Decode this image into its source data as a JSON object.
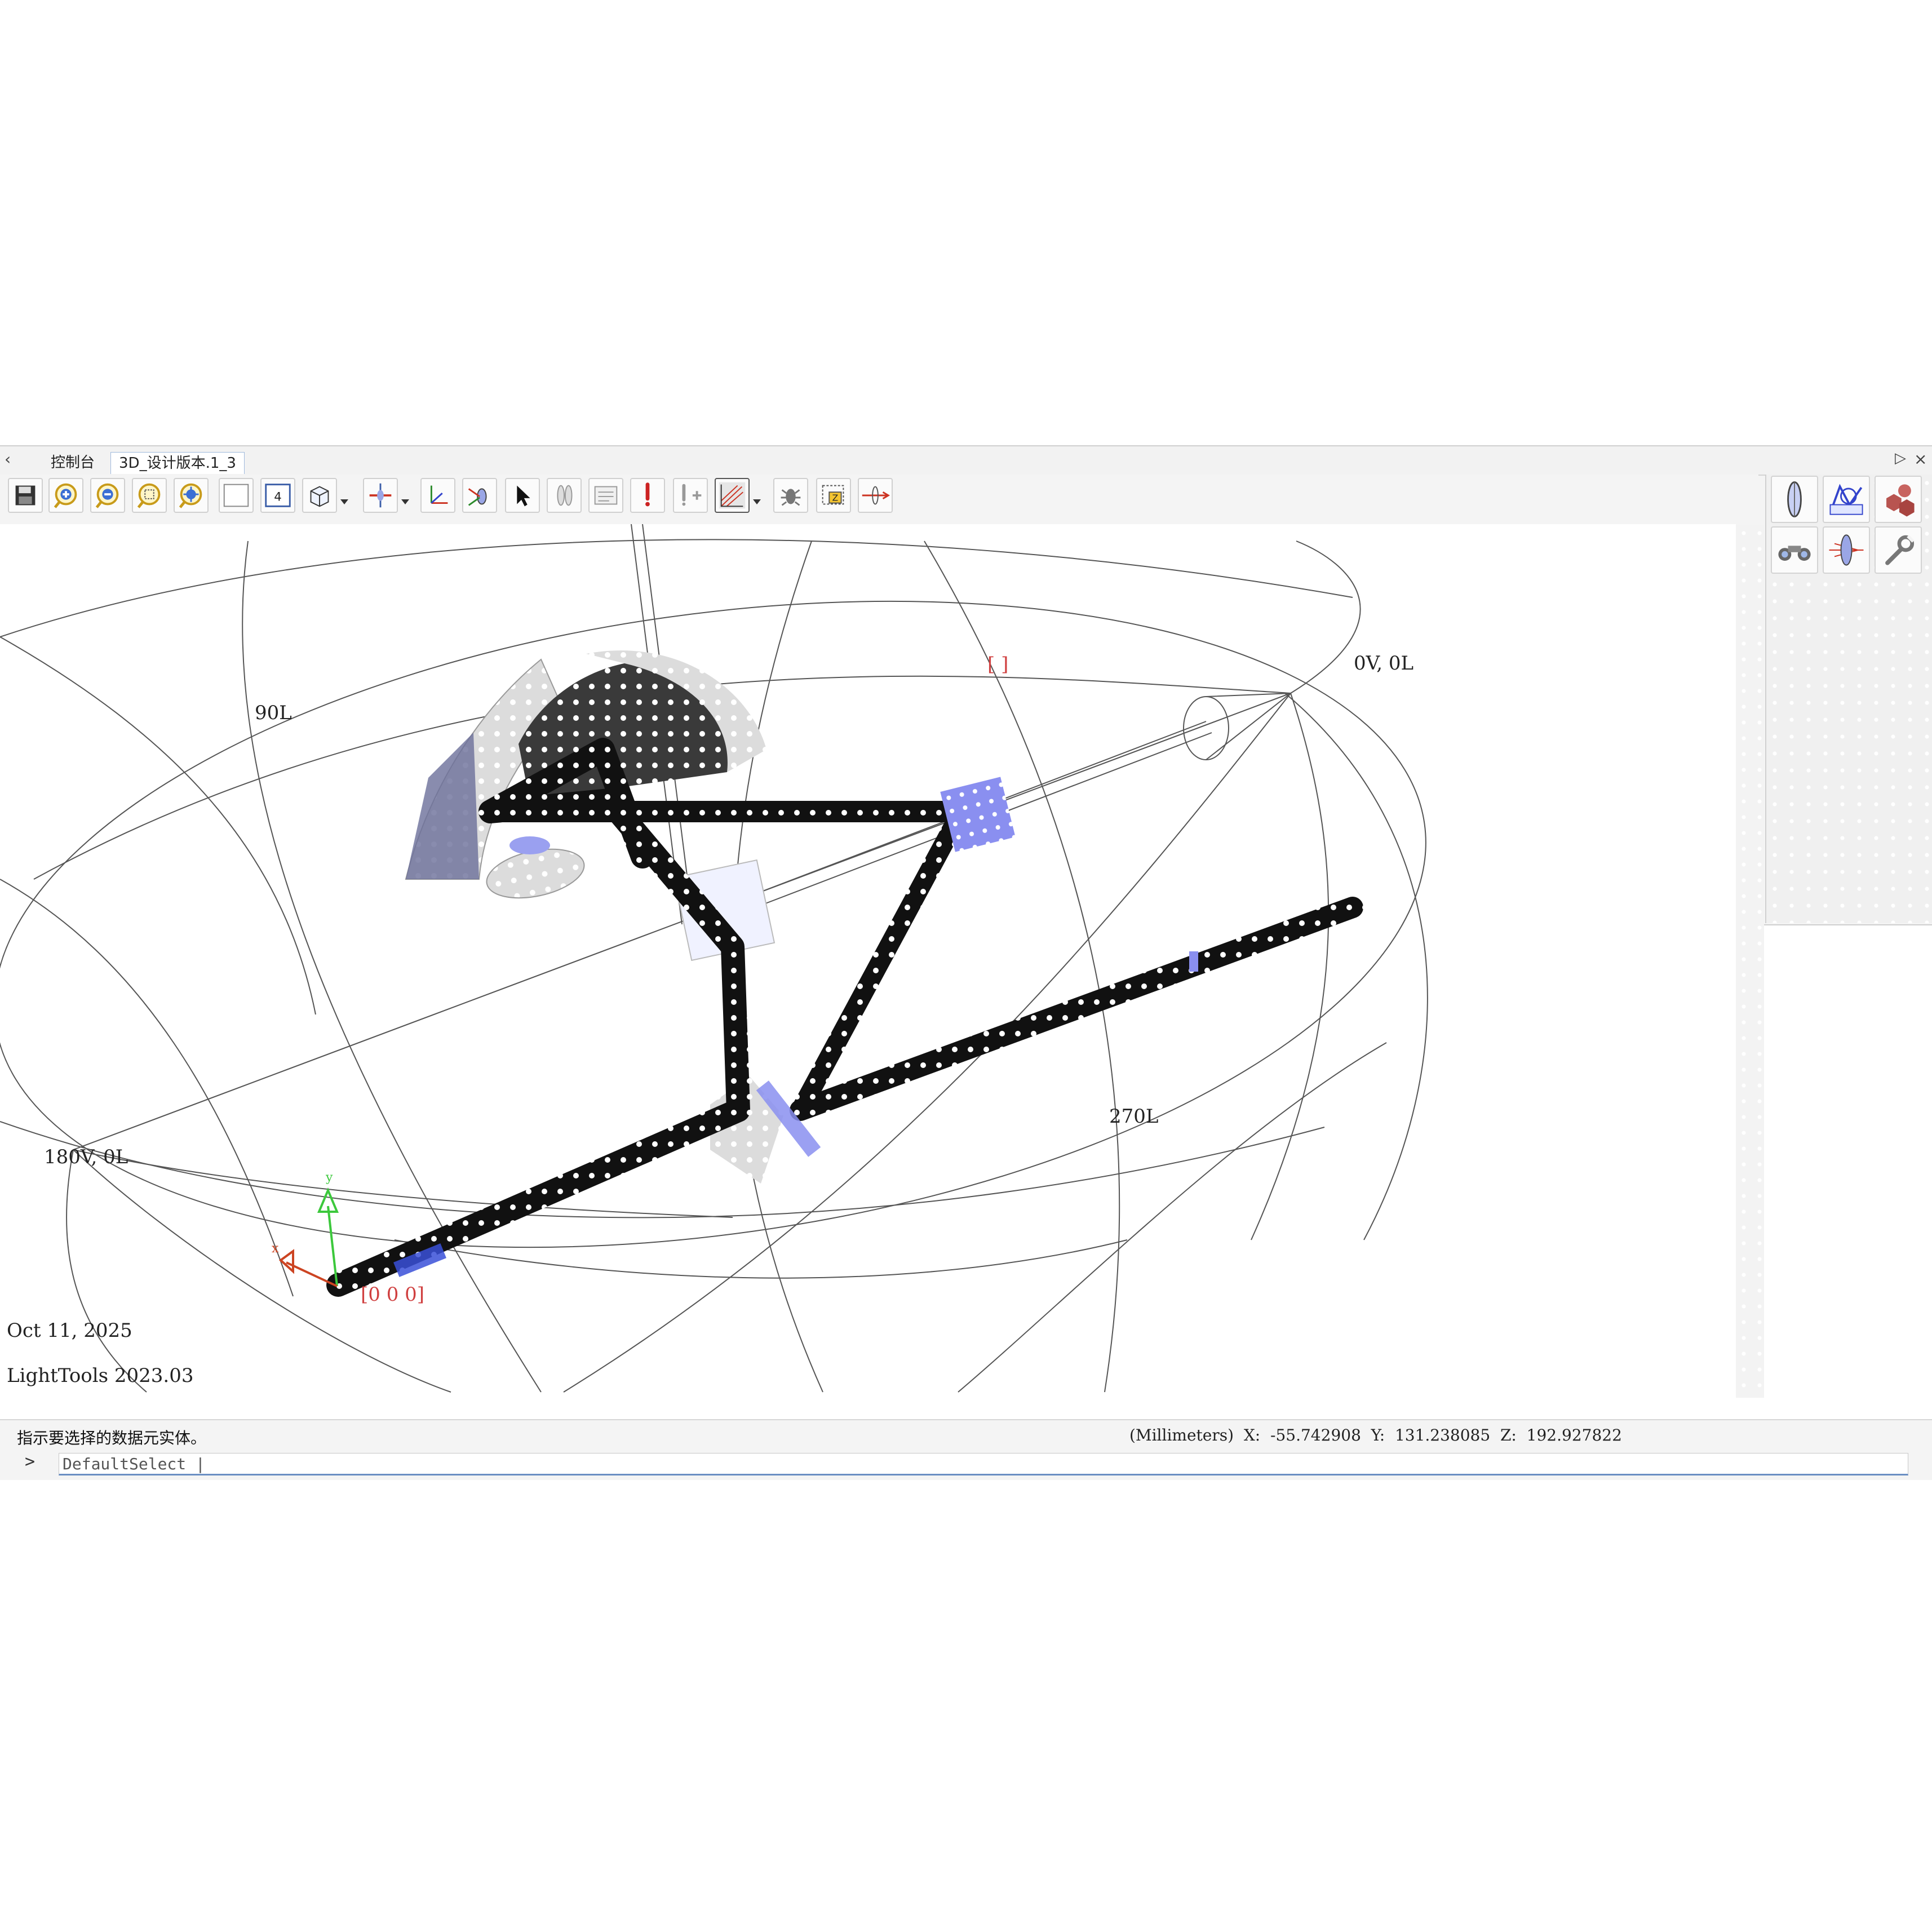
{
  "tabs": [
    {
      "label": "控制台"
    },
    {
      "label": "3D_设计版本.1_3"
    }
  ],
  "toolbar": {
    "buttons": [
      {
        "icon": "save-icon"
      },
      {
        "icon": "zoom-in-icon"
      },
      {
        "icon": "zoom-out-icon"
      },
      {
        "icon": "zoom-window-icon"
      },
      {
        "icon": "zoom-extents-icon"
      },
      {
        "icon": "blank-view-icon"
      },
      {
        "icon": "four-view-icon"
      },
      {
        "icon": "view-cube-icon"
      },
      {
        "icon": "plane-icon"
      },
      {
        "icon": "axes-icon"
      },
      {
        "icon": "rotate-icon"
      },
      {
        "icon": "select-arrow-icon"
      },
      {
        "icon": "lens-icon"
      },
      {
        "icon": "properties-icon"
      },
      {
        "icon": "alert-icon"
      },
      {
        "icon": "add-ray-icon"
      },
      {
        "icon": "ray-trace-icon"
      },
      {
        "icon": "bug-icon"
      },
      {
        "icon": "zoom-z-icon"
      },
      {
        "icon": "optical-axis-icon"
      }
    ],
    "four_view_label": "4"
  },
  "palette": {
    "buttons": [
      {
        "icon": "lens-element-icon"
      },
      {
        "icon": "sketch-icon"
      },
      {
        "icon": "solids-icon"
      },
      {
        "icon": "binoculars-icon"
      },
      {
        "icon": "illumination-lens-icon"
      },
      {
        "icon": "tools-icon"
      }
    ]
  },
  "viewport": {
    "labels": {
      "pole_top": "0V, 0L",
      "pole_left": "180V, 0L",
      "meridian_90": "90L",
      "meridian_270": "270L",
      "origin": "[0 0 0]",
      "bracket": "[ ]",
      "axis_y": "y",
      "axis_x": "x",
      "date": "Oct 11, 2025",
      "product": "LightTools 2023.03"
    }
  },
  "status": {
    "message": "指示要选择的数据元实体。",
    "coordinates": "(Millimeters)  X:  -55.742908  Y:  131.238085  Z:  192.927822"
  },
  "command": {
    "prompt": ">",
    "value": "DefaultSelect |"
  },
  "colors": {
    "beam": "#111111",
    "component_blue": "#8a8ff0",
    "origin_red": "#d04040",
    "axis_green": "#3cc83c",
    "axis_red": "#cc4422"
  }
}
